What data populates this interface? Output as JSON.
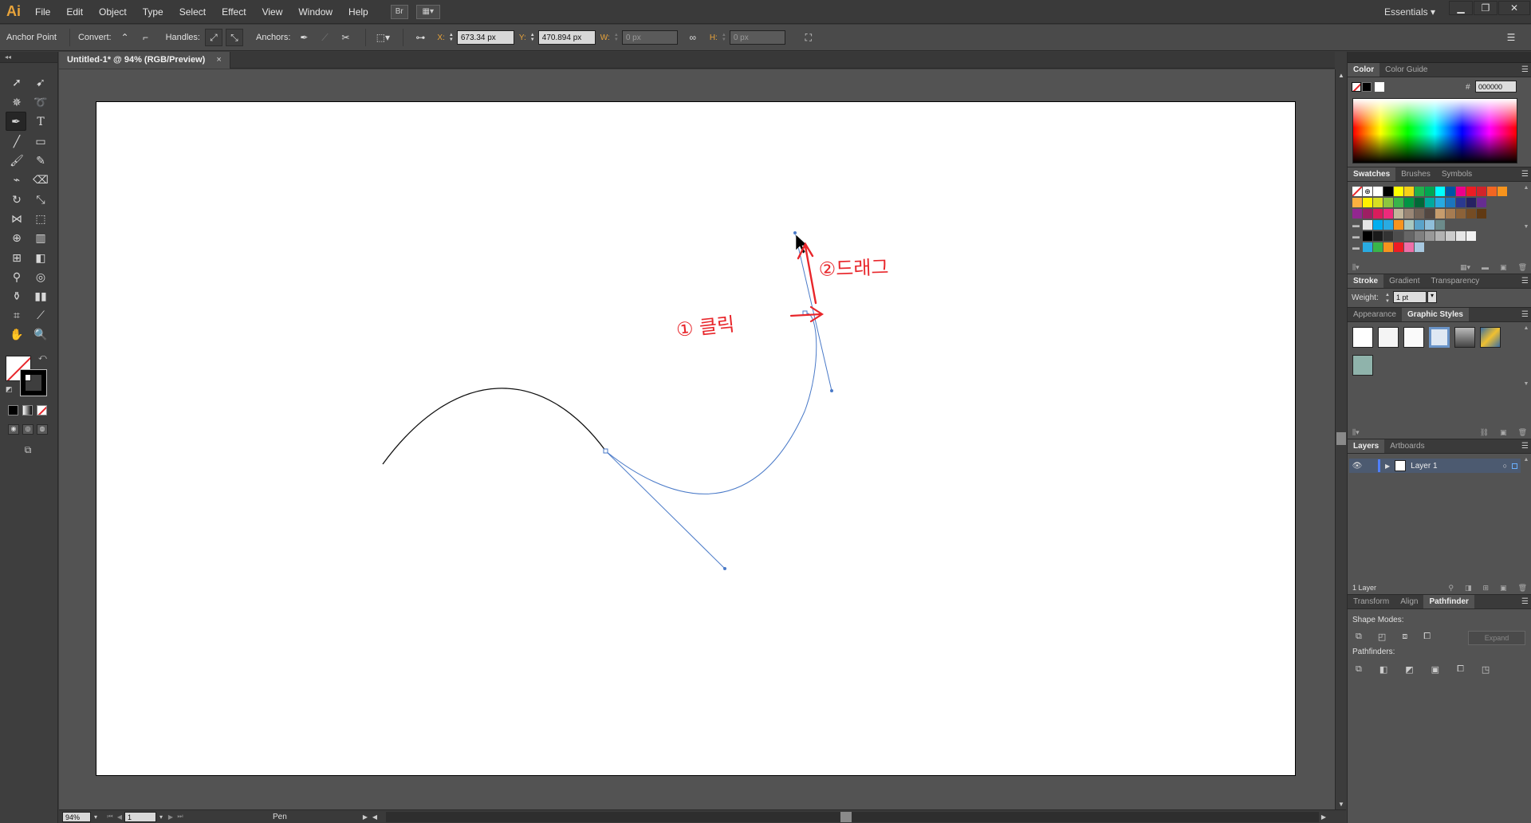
{
  "app": {
    "logo": "Ai",
    "menus": [
      "File",
      "Edit",
      "Object",
      "Type",
      "Select",
      "Effect",
      "View",
      "Window",
      "Help"
    ],
    "bridge_label": "Br",
    "workspace": "Essentials"
  },
  "control_bar": {
    "anchor_point_label": "Anchor Point",
    "convert_label": "Convert:",
    "handles_label": "Handles:",
    "anchors_label": "Anchors:",
    "x_label": "X:",
    "x_value": "673.34 px",
    "y_label": "Y:",
    "y_value": "470.894 px",
    "w_label": "W:",
    "w_value": "0 px",
    "h_label": "H:",
    "h_value": "0 px"
  },
  "document": {
    "tab_title": "Untitled-1* @ 94% (RGB/Preview)",
    "close_glyph": "×"
  },
  "annotations": {
    "click_label": "① 클릭",
    "drag_label": "②드래그",
    "color": "#e8262b"
  },
  "status_bar": {
    "zoom": "94%",
    "artboard_num": "1",
    "current_tool": "Pen"
  },
  "panels": {
    "color": {
      "tabs": [
        "Color",
        "Color Guide"
      ],
      "hex_label": "#",
      "hex_value": "000000"
    },
    "swatches": {
      "tabs": [
        "Swatches",
        "Brushes",
        "Symbols"
      ],
      "rows": [
        [
          "#ffffff",
          "#000000",
          "#ffff00",
          "#f7d117",
          "#22b14c",
          "#00a651",
          "#00ffff",
          "#0054a6",
          "#ec008c",
          "#ed1c24",
          "#d2232a",
          "#f26522",
          "#f7941d"
        ],
        [
          "#fbb040",
          "#fff200",
          "#d7df23",
          "#8dc63f",
          "#39b54a",
          "#009444",
          "#006838",
          "#00a99d",
          "#27aae1",
          "#1c75bc",
          "#2b3990",
          "#262262",
          "#662d91"
        ],
        [
          "#92278f",
          "#9e1f63",
          "#da1c5c",
          "#ee2a7b",
          "#c2b59b",
          "#998675",
          "#736357",
          "#534741",
          "#c69c6d",
          "#a67c52",
          "#8c6239",
          "#754c24",
          "#603913"
        ],
        [
          "#e6e6e6",
          "#00aeef",
          "#29abe2",
          "#f7941d",
          "#a7c8c1",
          "#5aa3c9",
          "#8fbfd9",
          "#6c8b8b"
        ],
        [
          "#000000",
          "#1a1a1a",
          "#333333",
          "#4d4d4d",
          "#666666",
          "#808080",
          "#999999",
          "#b3b3b3",
          "#cccccc",
          "#e6e6e6",
          "#f2f2f2"
        ],
        [
          "#29abe2",
          "#39b54a",
          "#f7941d",
          "#ed1c24",
          "#ee6fa8",
          "#a7c8e0"
        ]
      ]
    },
    "stroke": {
      "tabs": [
        "Stroke",
        "Gradient",
        "Transparency"
      ],
      "weight_label": "Weight:",
      "weight_value": "1 pt"
    },
    "graphic_styles": {
      "tabs": [
        "Appearance",
        "Graphic Styles"
      ]
    },
    "layers": {
      "tabs": [
        "Layers",
        "Artboards"
      ],
      "layer_name": "Layer 1",
      "count": "1 Layer"
    },
    "pathfinder": {
      "tabs": [
        "Transform",
        "Align",
        "Pathfinder"
      ],
      "shape_modes_label": "Shape Modes:",
      "expand_label": "Expand",
      "pathfinders_label": "Pathfinders:"
    }
  }
}
